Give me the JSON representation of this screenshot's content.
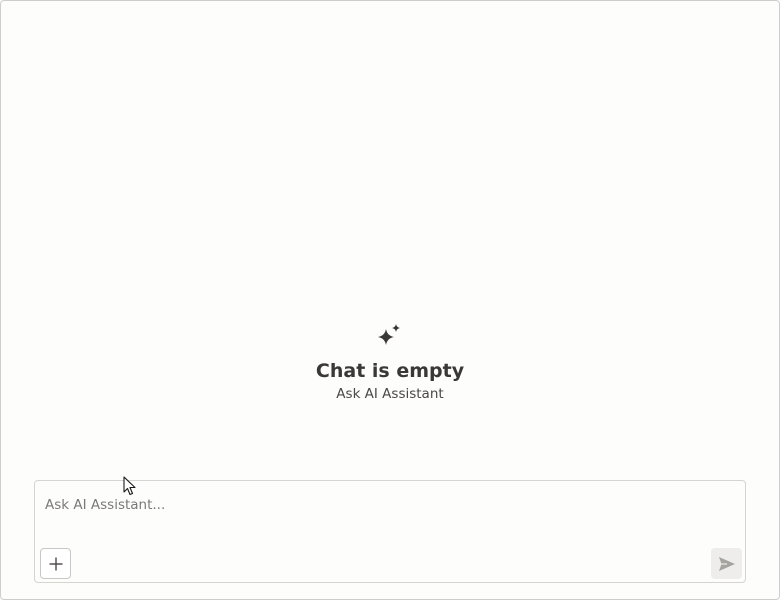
{
  "empty_state": {
    "icon": "sparkle-icon",
    "title": "Chat is empty",
    "subtitle": "Ask AI Assistant"
  },
  "composer": {
    "placeholder": "Ask AI Assistant...",
    "value": "",
    "add_icon": "plus-icon",
    "send_icon": "send-icon"
  },
  "colors": {
    "background": "#fdfdfc",
    "border": "#cfcdca",
    "title_text": "#3a3836",
    "placeholder_text": "#7b7976",
    "send_button_bg": "#eeedeb",
    "send_icon": "#a6a4a1"
  }
}
